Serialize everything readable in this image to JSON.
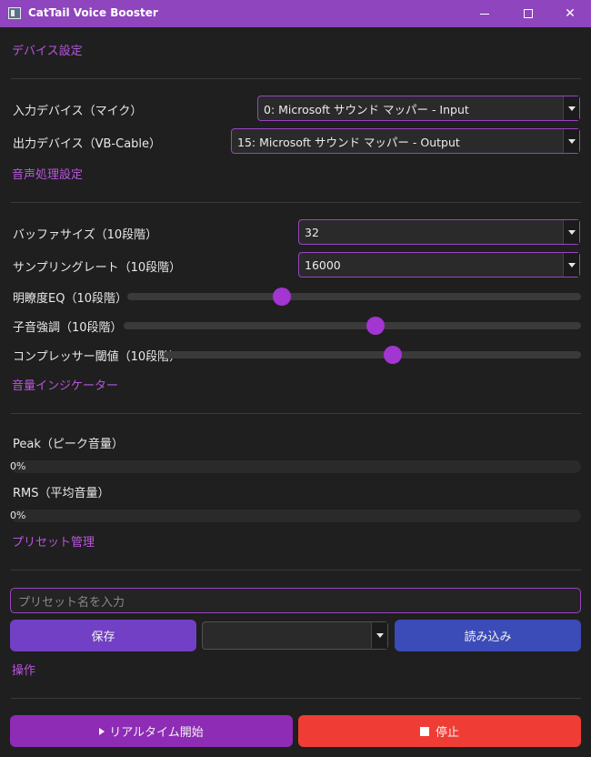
{
  "window": {
    "title": "CatTail Voice Booster"
  },
  "device": {
    "section_title": "デバイス設定",
    "input_label": "入力デバイス（マイク）",
    "input_value": "0: Microsoft サウンド マッパー - Input",
    "output_label": "出力デバイス（VB-Cable）",
    "output_value": "15: Microsoft サウンド マッパー - Output"
  },
  "audio": {
    "section_title": "音声処理設定",
    "buffer_label": "バッファサイズ（10段階）",
    "buffer_value": "32",
    "sampling_label": "サンプリングレート（10段階）",
    "sampling_value": "16000",
    "clarity_label": "明瞭度EQ（10段階）",
    "clarity_level": 0.34,
    "consonant_label": "子音強調（10段階）",
    "consonant_level": 0.55,
    "compressor_label": "コンプレッサー閾値（10段階）",
    "compressor_level": 0.55
  },
  "meter": {
    "section_title": "音量インジケーター",
    "peak_label": "Peak（ピーク音量）",
    "peak_value": "0%",
    "rms_label": "RMS（平均音量）",
    "rms_value": "0%"
  },
  "preset": {
    "section_title": "プリセット管理",
    "name_placeholder": "プリセット名を入力",
    "save_label": "保存",
    "select_value": "",
    "load_label": "読み込み"
  },
  "ops": {
    "section_title": "操作",
    "start_label": "リアルタイム開始",
    "stop_label": "停止"
  },
  "colors": {
    "accent": "#b955e0",
    "titlebar": "#8e45bd",
    "save": "#7140c4",
    "load": "#3b4bb8",
    "start": "#8e2cb6",
    "stop": "#ef3d35"
  }
}
